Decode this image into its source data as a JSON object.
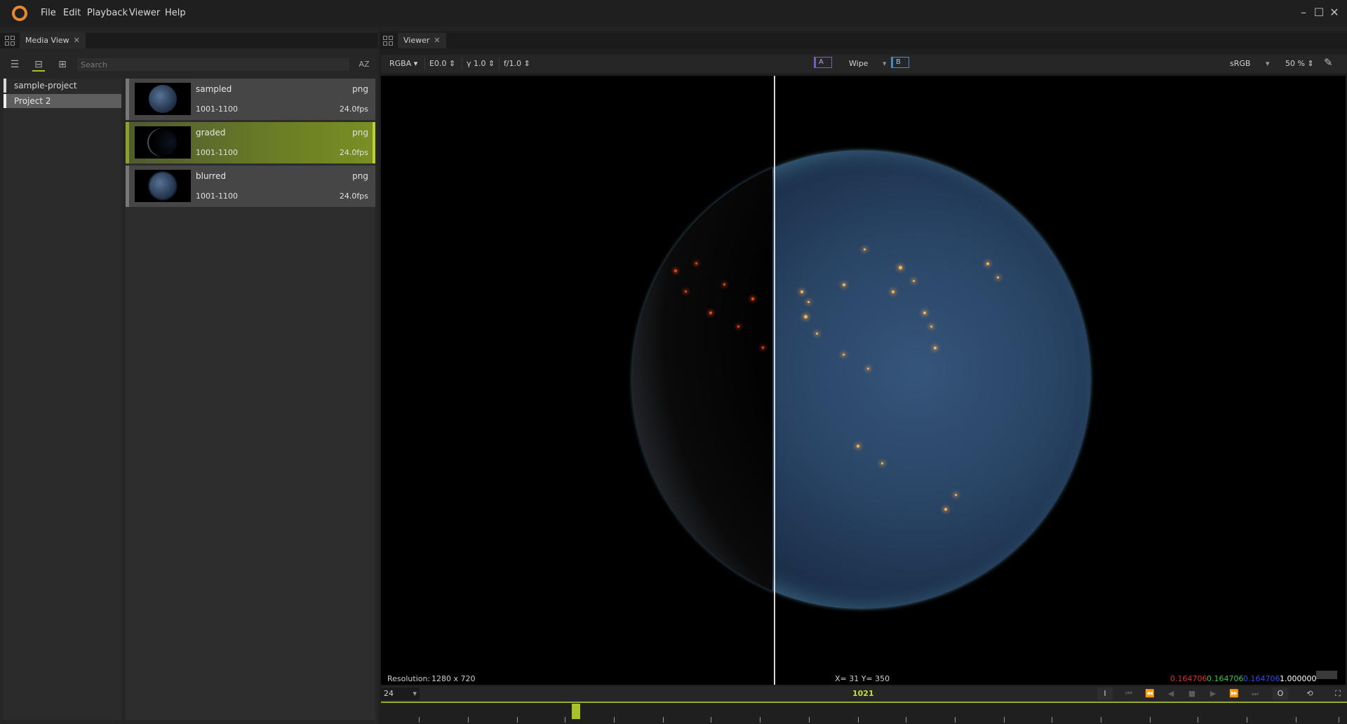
{
  "menu": {
    "items": [
      "File",
      "Edit",
      "Playback",
      "Viewer",
      "Help"
    ],
    "window_controls": {
      "minimize": "–",
      "maximize": "☐",
      "close": "✕"
    }
  },
  "media_view": {
    "tab_label": "Media View",
    "search_placeholder": "Search",
    "sort_label": "AZ",
    "projects": [
      {
        "label": "sample-project",
        "selected": false
      },
      {
        "label": "Project 2",
        "selected": true
      }
    ],
    "media": [
      {
        "name": "sampled",
        "type": "png",
        "range": "1001-1100",
        "fps": "24.0fps",
        "selected": false
      },
      {
        "name": "graded",
        "type": "png",
        "range": "1001-1100",
        "fps": "24.0fps",
        "selected": true
      },
      {
        "name": "blurred",
        "type": "png",
        "range": "1001-1100",
        "fps": "24.0fps",
        "selected": false
      }
    ]
  },
  "viewer": {
    "tab_label": "Viewer",
    "channels": "RGBA ▾",
    "exposure": "E0.0 ⇕",
    "gamma": "γ 1.0 ⇕",
    "fstop": "f/1.0 ⇕",
    "compare_a": "A",
    "compare_mode": "Wipe",
    "compare_b": "B",
    "colorspace": "sRGB",
    "zoom": "50 % ⇕",
    "resolution_label": "Resolution:",
    "resolution_value": "1280 x 720",
    "coords": "X=  31  Y=  350",
    "pixel_r": "0.164706",
    "pixel_g": "0.164706",
    "pixel_b": "0.164706",
    "pixel_a": "1.000000",
    "colors": {
      "accent": "#a9c22a",
      "logo": "#e8892f",
      "r": "#e03030",
      "g": "#3fc43f",
      "b": "#2f4fe0"
    }
  },
  "timeline": {
    "fps": "24",
    "current_frame": "1021",
    "in_marker": "I",
    "out_marker": "O"
  }
}
